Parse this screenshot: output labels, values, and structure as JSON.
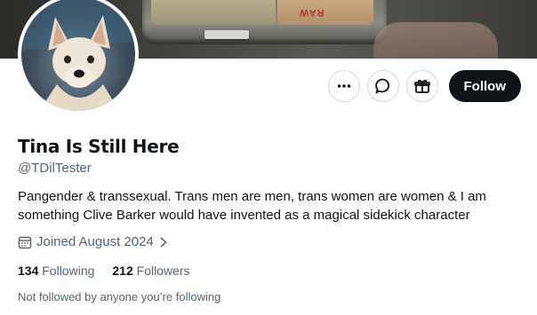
{
  "profile": {
    "name": "Tina Is Still Here",
    "handle": "@TDilTester",
    "bio": "Pangender & transsexual. Trans men are men, trans women are women & I am something Clive Barker would have invented as a magical sidekick character",
    "joined": "Joined August 2024",
    "following_count": "134",
    "following_label": "Following",
    "followers_count": "212",
    "followers_label": "Followers",
    "followed_by_note": "Not followed by anyone you’re following"
  },
  "actions": {
    "follow_label": "Follow"
  },
  "banner": {
    "logo_text": "RAW"
  },
  "icons": {
    "more": "more-horizontal-icon",
    "message": "message-bubble-icon",
    "gift": "gift-icon",
    "calendar": "calendar-icon",
    "chevron": "chevron-right-icon"
  },
  "colors": {
    "follow_bg": "#0f1419",
    "secondary_text": "#536471",
    "border": "#cfd9de"
  }
}
